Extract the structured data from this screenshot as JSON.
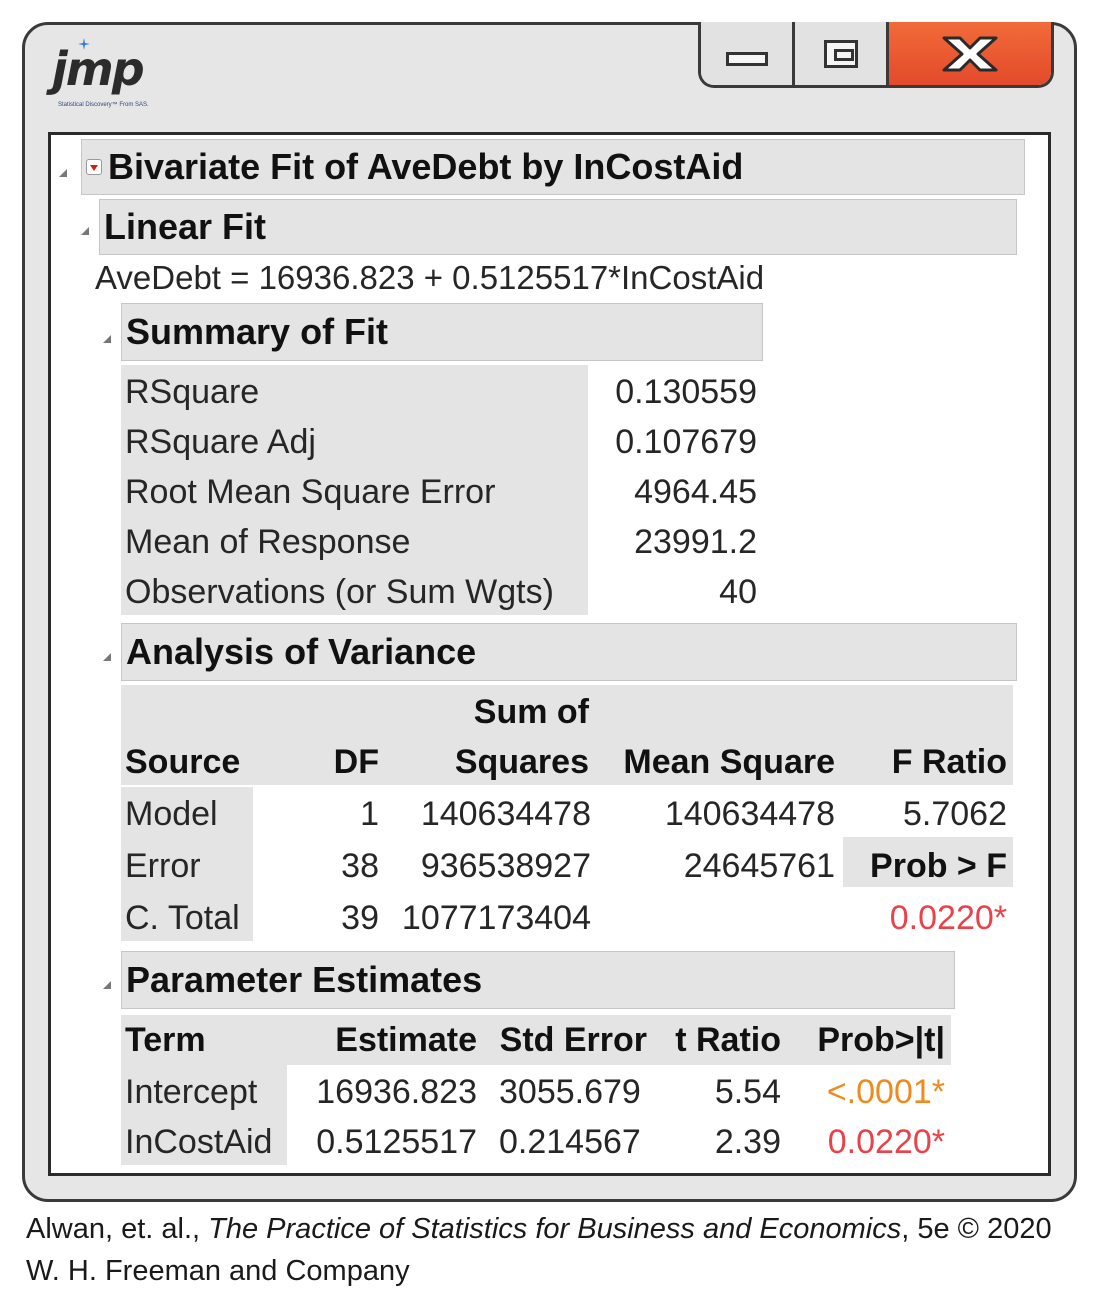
{
  "logo": {
    "name": "jmp",
    "tagline": "Statistical Discovery™ From SAS."
  },
  "window": {
    "minimize": "minimize",
    "maximize": "maximize",
    "close": "close"
  },
  "report": {
    "title": "Bivariate Fit of AveDebt by InCostAid",
    "linear_fit": {
      "header": "Linear Fit",
      "equation": "AveDebt = 16936.823 + 0.5125517*InCostAid"
    },
    "summary_of_fit": {
      "header": "Summary of Fit",
      "rows": [
        {
          "label": "RSquare",
          "value": "0.130559"
        },
        {
          "label": "RSquare Adj",
          "value": "0.107679"
        },
        {
          "label": "Root Mean Square Error",
          "value": "4964.45"
        },
        {
          "label": "Mean of Response",
          "value": "23991.2"
        },
        {
          "label": "Observations (or Sum Wgts)",
          "value": "40"
        }
      ]
    },
    "anova": {
      "header": "Analysis of Variance",
      "columns": {
        "source": "Source",
        "df": "DF",
        "ss_line1": "Sum of",
        "ss_line2": "Squares",
        "ms": "Mean Square",
        "f": "F Ratio"
      },
      "rows": [
        {
          "source": "Model",
          "df": "1",
          "ss": "140634478",
          "ms": "140634478",
          "f": "5.7062"
        },
        {
          "source": "Error",
          "df": "38",
          "ss": "936538927",
          "ms": "24645761",
          "f": "Prob > F"
        },
        {
          "source": "C. Total",
          "df": "39",
          "ss": "1077173404",
          "ms": "",
          "f": "0.0220*"
        }
      ]
    },
    "parameter_estimates": {
      "header": "Parameter Estimates",
      "columns": {
        "term": "Term",
        "estimate": "Estimate",
        "stderr": "Std Error",
        "tratio": "t Ratio",
        "prob": "Prob>|t|"
      },
      "rows": [
        {
          "term": "Intercept",
          "estimate": "16936.823",
          "stderr": "3055.679",
          "tratio": "5.54",
          "prob": "<.0001*"
        },
        {
          "term": "InCostAid",
          "estimate": "0.5125517",
          "stderr": "0.214567",
          "tratio": "2.39",
          "prob": "0.0220*"
        }
      ]
    }
  },
  "caption": {
    "authors": "Alwan, et. al., ",
    "book": "The Practice of Statistics for Business and Economics",
    "edition": ", 5e © 2020",
    "publisher": "W. H. Freeman and Company"
  },
  "colors": {
    "significant_red": "#e8424a",
    "highly_significant_orange": "#f08a1c",
    "close_button": "#e34a2a"
  }
}
